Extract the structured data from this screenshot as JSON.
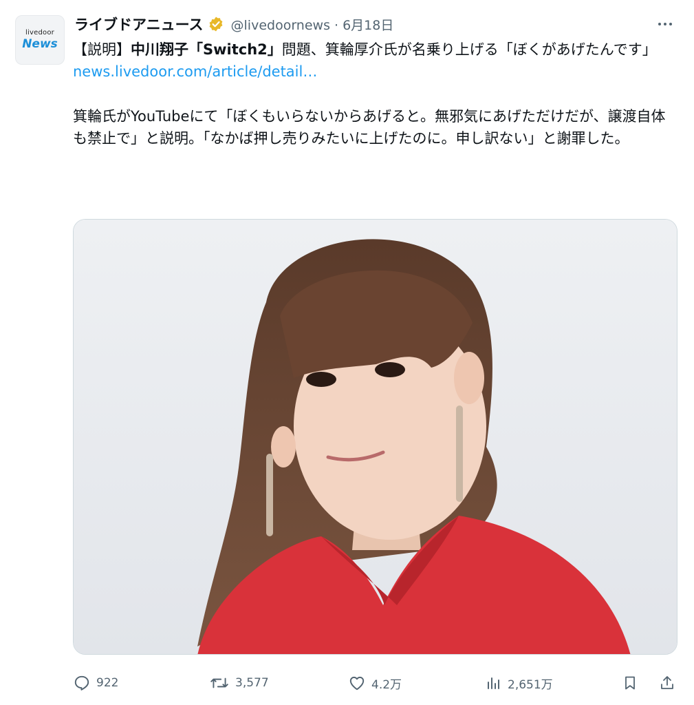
{
  "account": {
    "avatar_line1": "livedoor",
    "avatar_line2": "News",
    "display_name": "ライブドアニュース",
    "handle_date": "@livedoornews · 6月18日",
    "verified_badge_icon": "verified-gold-badge"
  },
  "tweet": {
    "seg1": "【説明】",
    "seg2_bold": "中川翔子「Switch2」",
    "seg3": "問題、箕輪厚介氏が名乗り上げる「ぼくがあげたんです」",
    "link": "news.livedoor.com/article/detail…",
    "para2": "箕輪氏がYouTubeにて「ぼくもいらないからあげると。無邪気にあげただけだが、譲渡自体も禁止で」と説明。「なかば押し売りみたいに上げたのに。申し訳ない」と謝罪した。"
  },
  "actions": {
    "reply_count": "922",
    "retweet_count": "3,577",
    "like_count": "4.2万",
    "views_count": "2,651万"
  },
  "colors": {
    "link": "#1d9bf0",
    "secondary_text": "#536471",
    "badge_gold": "#e8b828",
    "dress_red": "#d9323a"
  },
  "icons": [
    "reply-icon",
    "retweet-icon",
    "like-icon",
    "views-icon",
    "bookmark-icon",
    "share-icon",
    "more-icon"
  ]
}
